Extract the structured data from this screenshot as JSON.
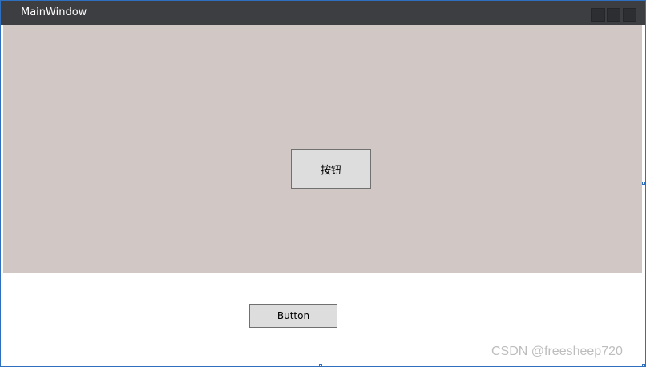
{
  "window": {
    "title": "MainWindow"
  },
  "content": {
    "upper_button_label": "按钮",
    "lower_button_label": "Button"
  },
  "watermark": "CSDN @freesheep720",
  "colors": {
    "titlebar": "#3d3e42",
    "upper_panel": "#d1c7c5",
    "lower_panel": "#ffffff",
    "button_bg": "#dddddd",
    "selection_border": "#2f6fbf"
  },
  "icons": {
    "minimize": "minimize-icon",
    "maximize": "maximize-icon",
    "close": "close-icon"
  }
}
